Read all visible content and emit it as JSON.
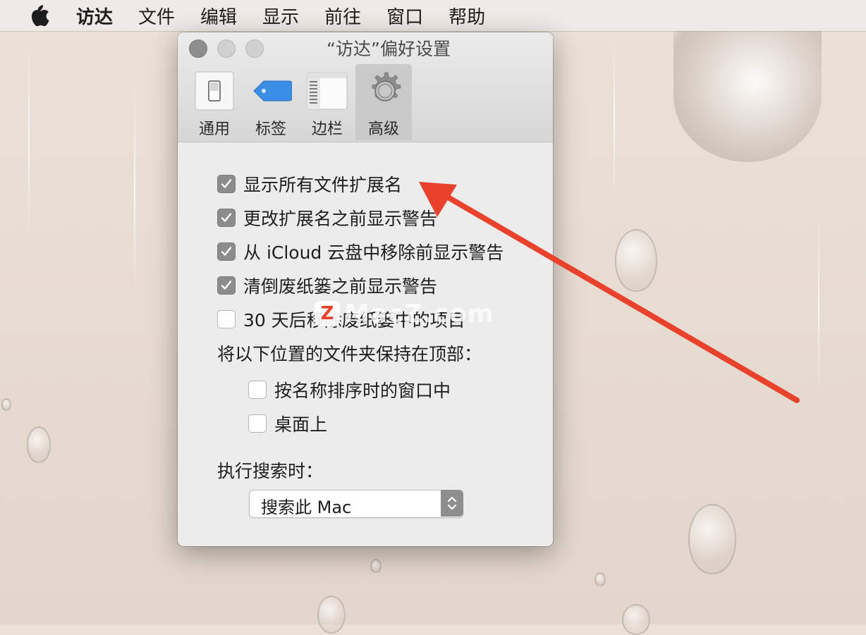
{
  "menubar": {
    "apple": "apple-logo-icon",
    "app_name": "访达",
    "items": [
      "文件",
      "编辑",
      "显示",
      "前往",
      "窗口",
      "帮助"
    ]
  },
  "window": {
    "title": "“访达”偏好设置",
    "tabs": [
      {
        "label": "通用",
        "icon": "general-switch-icon",
        "active": false
      },
      {
        "label": "标签",
        "icon": "tag-icon",
        "active": false
      },
      {
        "label": "边栏",
        "icon": "sidebar-icon",
        "active": false
      },
      {
        "label": "高级",
        "icon": "gear-icon",
        "active": true
      }
    ],
    "options": [
      {
        "label": "显示所有文件扩展名",
        "checked": true
      },
      {
        "label": "更改扩展名之前显示警告",
        "checked": true
      },
      {
        "label": "从 iCloud 云盘中移除前显示警告",
        "checked": true
      },
      {
        "label": "清倒废纸篓之前显示警告",
        "checked": true
      },
      {
        "label": "30 天后移除废纸篓中的项目",
        "checked": false
      }
    ],
    "folders_top_label": "将以下位置的文件夹保持在顶部：",
    "folders_top_options": [
      {
        "label": "按名称排序时的窗口中",
        "checked": false
      },
      {
        "label": "桌面上",
        "checked": false
      }
    ],
    "search_label": "执行搜索时：",
    "search_scope": "搜索此 Mac"
  },
  "watermark": {
    "text": "MacZ.com",
    "logo": "Z"
  },
  "colors": {
    "arrow": "#e8412c",
    "checkbox_on": "#8c8c8c",
    "window_bg": "#ececec"
  }
}
